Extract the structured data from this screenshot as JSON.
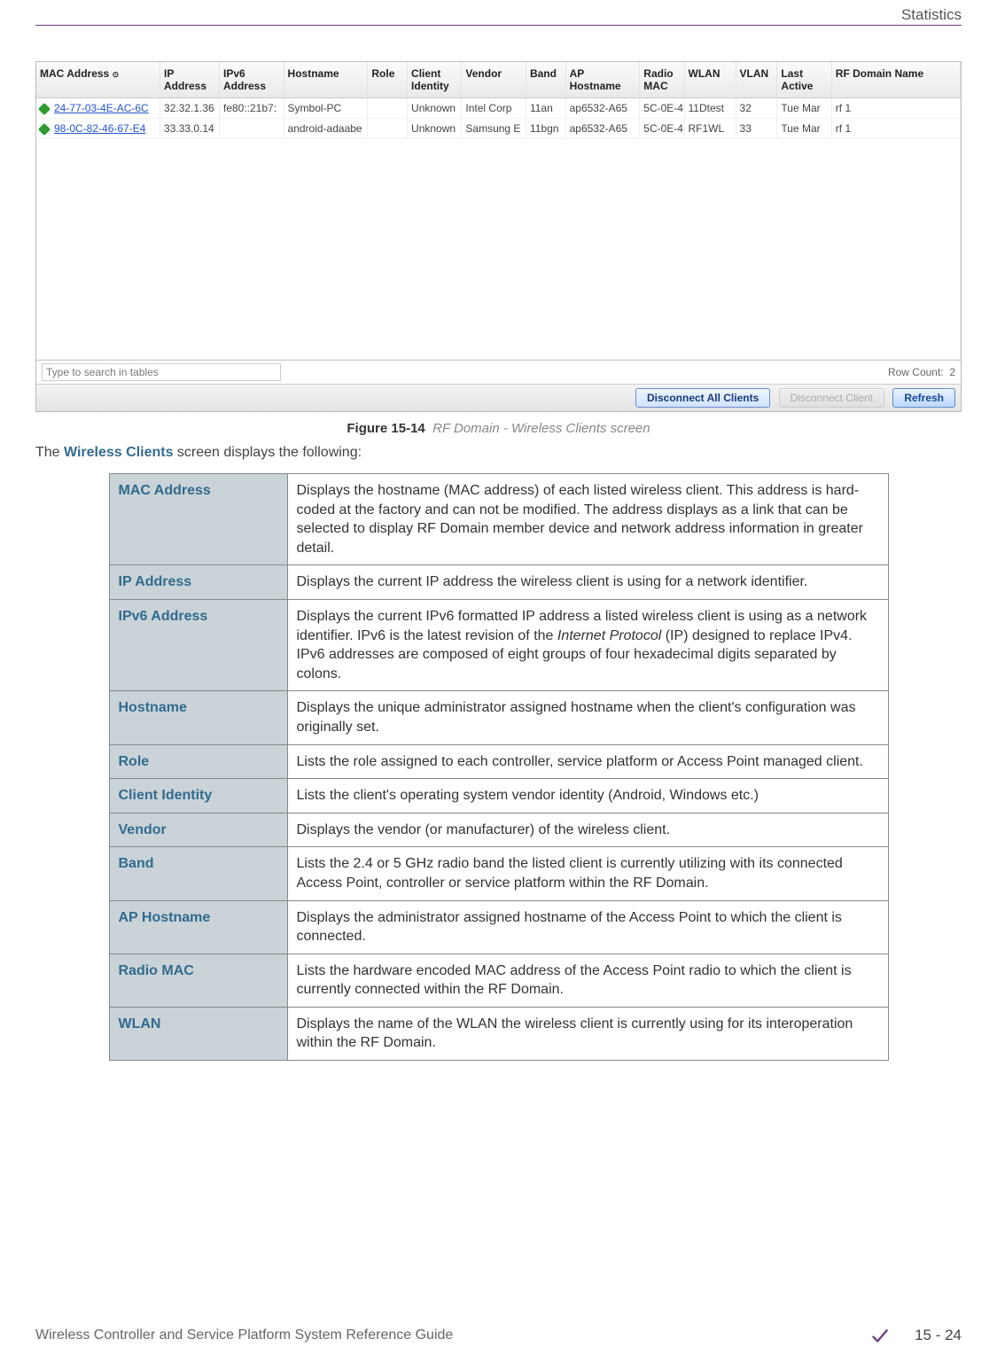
{
  "page": {
    "section_label": "Statistics",
    "footer_text": "Wireless Controller and Service Platform System Reference Guide",
    "page_number": "15 - 24"
  },
  "figure": {
    "label_bold": "Figure 15-14",
    "label_ital": "RF Domain - Wireless Clients screen"
  },
  "intro": {
    "pre": "The ",
    "bold": "Wireless Clients",
    "post": " screen displays the following:"
  },
  "screenshot": {
    "headers": [
      "MAC Address",
      "IP Address",
      "IPv6 Address",
      "Hostname",
      "Role",
      "Client Identity",
      "Vendor",
      "Band",
      "AP Hostname",
      "Radio MAC",
      "WLAN",
      "VLAN",
      "Last Active",
      "RF Domain Name"
    ],
    "rows": [
      {
        "mac": "24-77-03-4E-AC-6C",
        "ip": "32.32.1.36",
        "ipv6": "fe80::21b7:",
        "hostname": "Symbol-PC",
        "role": "",
        "client_identity": "Unknown",
        "vendor": "Intel Corp",
        "band": "11an",
        "ap_hostname": "ap6532-A65",
        "radio_mac": "5C-0E-4",
        "wlan": "11Dtest",
        "vlan": "32",
        "last_active": "Tue Mar",
        "rf_domain": "rf 1"
      },
      {
        "mac": "98-0C-82-46-67-E4",
        "ip": "33.33.0.14",
        "ipv6": "",
        "hostname": "android-adaabe",
        "role": "",
        "client_identity": "Unknown",
        "vendor": "Samsung E",
        "band": "11bgn",
        "ap_hostname": "ap6532-A65",
        "radio_mac": "5C-0E-4",
        "wlan": "RF1WL",
        "vlan": "33",
        "last_active": "Tue Mar",
        "rf_domain": "rf 1"
      }
    ],
    "search_placeholder": "Type to search in tables",
    "row_count_label": "Row Count:",
    "row_count_value": "2",
    "buttons": {
      "disconnect_all": "Disconnect All Clients",
      "disconnect_client": "Disconnect Client",
      "refresh": "Refresh"
    }
  },
  "desc": [
    {
      "term": "MAC Address",
      "text": "Displays the hostname (MAC address) of each listed wireless client. This address is hard-coded at the factory and can not be modified. The address displays as a link that can be selected to display RF Domain member device and network address information in greater detail."
    },
    {
      "term": "IP Address",
      "text": "Displays the current IP address the wireless client is using for a network identifier."
    },
    {
      "term": "IPv6 Address",
      "text_parts": [
        "Displays the current IPv6 formatted IP address a listed wireless client is using as a network identifier. IPv6 is the latest revision of the ",
        "Internet Protocol",
        " (IP) designed to replace IPv4. IPv6 addresses are composed of eight groups of four hexadecimal digits separated by colons."
      ]
    },
    {
      "term": "Hostname",
      "text": "Displays the unique administrator assigned hostname when the client's configuration was originally set."
    },
    {
      "term": "Role",
      "text": "Lists the role assigned to each controller, service platform or Access Point managed client."
    },
    {
      "term": "Client Identity",
      "text": "Lists the client's operating system vendor identity (Android, Windows etc.)"
    },
    {
      "term": "Vendor",
      "text": "Displays the vendor (or manufacturer) of the wireless client."
    },
    {
      "term": "Band",
      "text": "Lists the 2.4 or 5 GHz radio band the listed client is currently utilizing with its connected Access Point, controller or service platform within the RF Domain."
    },
    {
      "term": "AP Hostname",
      "text": "Displays the administrator assigned hostname of the Access Point to which the client is connected."
    },
    {
      "term": "Radio MAC",
      "text": "Lists the hardware encoded MAC address of the Access Point radio to which the client is currently connected within the RF Domain."
    },
    {
      "term": "WLAN",
      "text": "Displays the name of the WLAN the wireless client is currently using for its interoperation within the RF Domain."
    }
  ]
}
